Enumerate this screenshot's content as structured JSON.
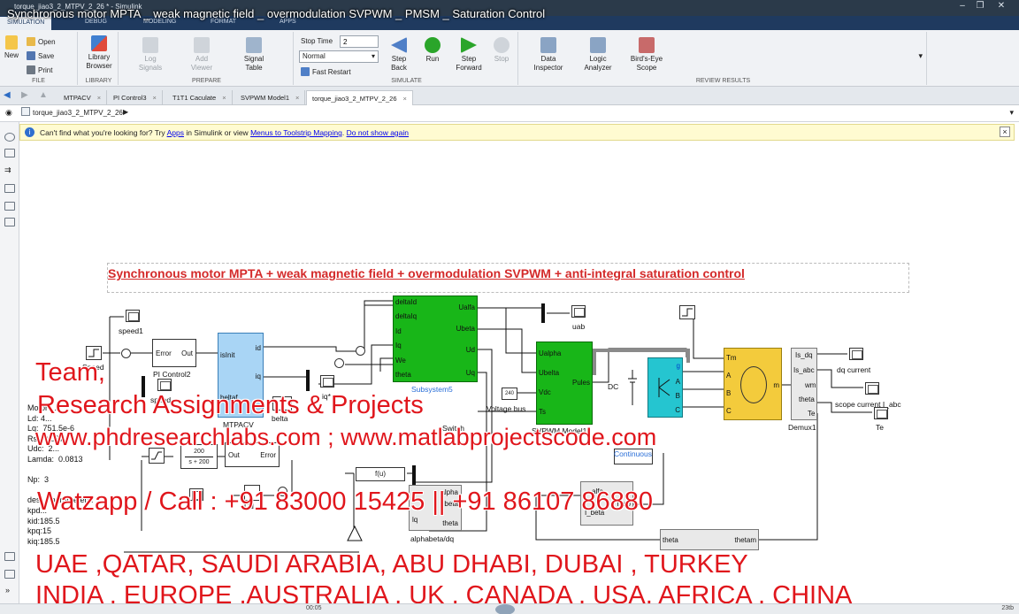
{
  "window": {
    "app_title": "torque_jiao3_2_MTPV_2_26 * - Simulink",
    "video_title": "Synchronous motor MPTA _ weak magnetic field _ overmodulation SVPWM _ PMSM _ Saturation Control"
  },
  "ribbon_tabs": [
    {
      "label": "SIMULATION"
    },
    {
      "label": "DEBUG"
    },
    {
      "label": "MODELING"
    },
    {
      "label": "FORMAT"
    },
    {
      "label": "APPS"
    }
  ],
  "ribbon": {
    "file": {
      "new_label": "New",
      "open_label": "Open",
      "save_label": "Save",
      "print_label": "Print",
      "group_label": "FILE"
    },
    "library": {
      "browser_label": "Library Browser",
      "group_label": "LIBRARY"
    },
    "prepare": {
      "log_signals_label": "Log Signals",
      "add_viewer_label": "Add Viewer",
      "signal_table_label": "Signal Table",
      "group_label": "PREPARE"
    },
    "simulate": {
      "stop_time_label": "Stop Time",
      "stop_time_value": "2",
      "mode_value": "Normal",
      "fast_restart_label": "Fast Restart",
      "step_back_label": "Step Back",
      "run_label": "Run",
      "step_forward_label": "Step Forward",
      "stop_label": "Stop",
      "group_label": "SIMULATE"
    },
    "review": {
      "data_inspector_label": "Data Inspector",
      "logic_analyzer_label": "Logic Analyzer",
      "birds_eye_label": "Bird's-Eye Scope",
      "group_label": "REVIEW RESULTS"
    }
  },
  "doc_tabs": [
    {
      "label": "MTPACV"
    },
    {
      "label": "PI Control3"
    },
    {
      "label": "T1T1 Caculate"
    },
    {
      "label": "SVPWM Model1"
    },
    {
      "label": "torque_jiao3_2_MTPV_2_26"
    }
  ],
  "address": {
    "path": "torque_jiao3_2_MTPV_2_26"
  },
  "infobar": {
    "text1": "Can't find what you're looking for? Try ",
    "link1": "Apps",
    "text2": " in Simulink or view ",
    "link2": "Menus to Toolstrip Mapping",
    "text3": ". ",
    "link3": "Do not show again"
  },
  "diagram": {
    "annotation": "Synchronous motor MPTA + weak magnetic field + overmodulation SVPWM + anti-integral saturation control",
    "blocks": {
      "speed1": "speed1",
      "speed": "Speed",
      "pi_control2": "PI Control2",
      "pi_error": "Error",
      "pi_out": "Out",
      "mtpacv": "MTPACV",
      "mtpacv_isinit": "isInit",
      "mtpacv_beltaf": "beltaf",
      "mtpacv_id": "id",
      "mtpacv_iq": "iq",
      "belta": "belta",
      "speed_scope": "speed",
      "id_star": "id*",
      "iq_star": "iq*",
      "subsystem5": "Subsystem5",
      "sub_inputs": [
        "deltaId",
        "deltaIq",
        "Id",
        "Iq",
        "We",
        "theta"
      ],
      "sub_outputs": [
        "Ualfa",
        "Ubeta",
        "Ud",
        "Uq"
      ],
      "uab": "uab",
      "svpwm": "SVPWM Model1",
      "sv_inputs": [
        "Ualpha",
        "Ubelta",
        "Vdc",
        "Ts"
      ],
      "sv_out": "Pules",
      "voltage_bus": "Voltage bus",
      "vbus_value": "240",
      "switch": "Switch",
      "dc": "DC",
      "inverter_g": "g",
      "inv_out": [
        "A",
        "B",
        "C"
      ],
      "motor_in": [
        "Tm",
        "A",
        "B",
        "C"
      ],
      "motor_out": "m",
      "demux": "Demux1",
      "demux_ports": [
        "Is_dq",
        "Is_abc",
        "wm",
        "theta",
        "Te"
      ],
      "dq_current": "dq current",
      "scope_current": "scope current I_abc",
      "te": "Te",
      "continuous": "Continuous",
      "fu": "f(u)",
      "tf_num": "200",
      "tf_den": "s + 200",
      "ud": "Ud",
      "alphabeta_dq": "alphabeta/dq",
      "ab_ports": [
        "alpha",
        "beta",
        "theta",
        "lq"
      ],
      "abc_ab": [
        "alfa",
        "I_beta",
        "I_ab"
      ],
      "theta_blk": [
        "theta",
        "thetam"
      ],
      "err_out": [
        "Out",
        "Error"
      ]
    },
    "params": {
      "motor": "Motor ...",
      "ld": "Ld: 4...",
      "lq": "Lq:  751.5e-6",
      "rs": "Rs:  0.037",
      "udc": "Udc:  2...",
      "lamda": "Lamda:  0.0813",
      "np": "Np:  3",
      "design": "desi... parameters:",
      "kpd": "kpd...",
      "kid": "kid:185.5",
      "kpq": "kpq:15",
      "kiq": "kiq:185.5"
    }
  },
  "watermark": {
    "line1": "Team,",
    "line2": "Research Assignments & Projects",
    "line3": "www.phdresearchlabs.com ; www.matlabprojectscode.com",
    "line4": "Watzapp / Call : +91 83000 15425 || +91 86107 86880",
    "line5": "UAE ,QATAR, SAUDI ARABIA, ABU DHABI, DUBAI , TURKEY",
    "line6": "INDIA , EUROPE ,AUSTRALIA , UK , CANADA , USA, AFRICA , CHINA"
  },
  "status": {
    "time": "00:05",
    "right": "23tb"
  },
  "colors": {
    "brand_dark": "#1f3a5f",
    "subsystem_green": "#18b618",
    "mtpacv_blue": "#a9d5f5",
    "inverter_cyan": "#25c5d0",
    "motor_yellow": "#f3cb3c",
    "watermark_red": "#e0161c",
    "annotation_red": "#d42a2a"
  }
}
